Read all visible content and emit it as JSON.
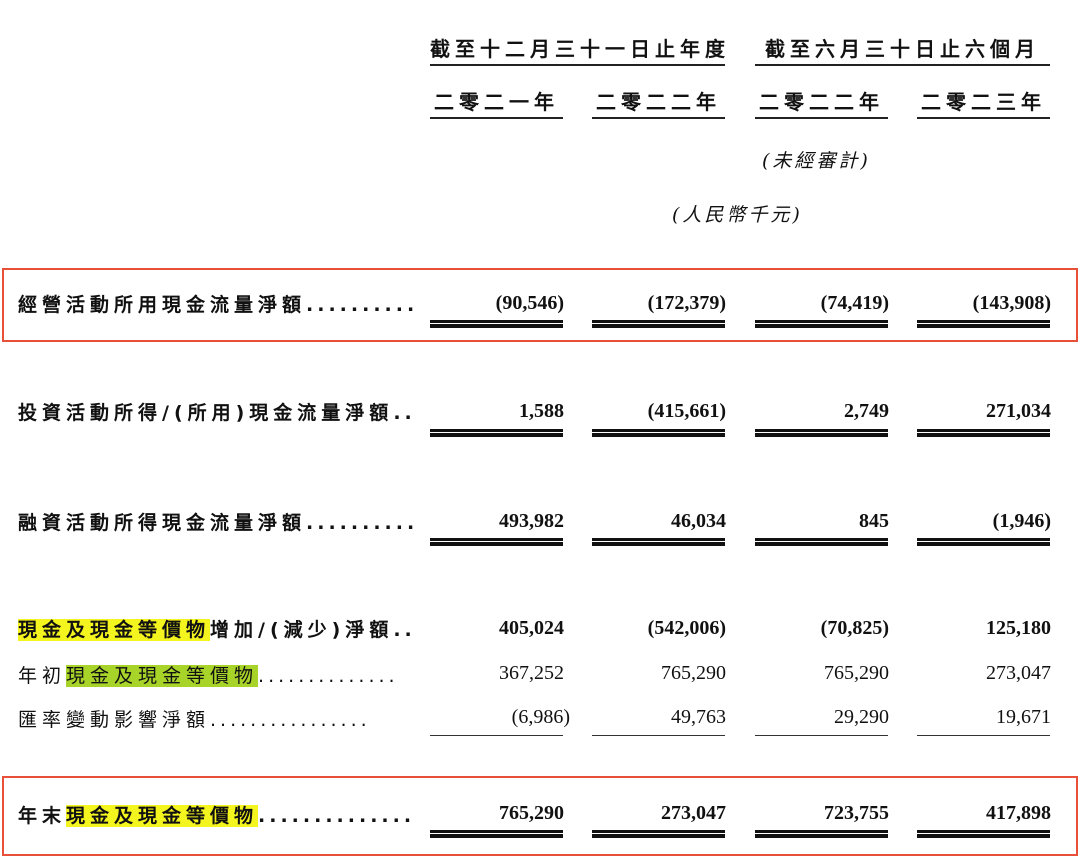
{
  "header": {
    "period_full_year": "截至十二月三十一日止年度",
    "period_six_months": "截至六月三十日止六個月",
    "years": [
      "二零二一年",
      "二零二二年",
      "二零二二年",
      "二零二三年"
    ],
    "unaudited": "(未經審計)",
    "currency": "(人民幣千元)"
  },
  "rows": [
    {
      "pre": "",
      "hl": "",
      "mid": "",
      "hl2": "",
      "post": "經營活動所用現金流量淨額",
      "dots": "..........",
      "values": [
        "(90,546)",
        "(172,379)",
        "(74,419)",
        "(143,908)"
      ]
    },
    {
      "pre": "",
      "hl": "",
      "mid": "",
      "hl2": "",
      "post": "投資活動所得/(所用)現金流量淨額",
      "dots": "..",
      "values": [
        "1,588",
        "(415,661)",
        "2,749",
        "271,034"
      ]
    },
    {
      "pre": "",
      "hl": "",
      "mid": "",
      "hl2": "",
      "post": "融資活動所得現金流量淨額",
      "dots": "..........",
      "values": [
        "493,982",
        "46,034",
        "845",
        "(1,946)"
      ]
    },
    {
      "pre": "",
      "hl": "現金及現金等價物",
      "mid": "",
      "hl2": "",
      "post": "增加/(減少)淨額",
      "dots": "..",
      "values": [
        "405,024",
        "(542,006)",
        "(70,825)",
        "125,180"
      ]
    },
    {
      "pre": "年初",
      "hl": "",
      "mid": "",
      "hl2": "現金及現金等價物",
      "post": "",
      "dots": "..............",
      "values": [
        "367,252",
        "765,290",
        "765,290",
        "273,047"
      ]
    },
    {
      "pre": "",
      "hl": "",
      "mid": "",
      "hl2": "",
      "post": "匯率變動影響淨額",
      "dots": "................",
      "values": [
        "(6,986)",
        "49,763",
        "29,290",
        "19,671"
      ]
    },
    {
      "pre": "年末",
      "hl": "現金及現金等價物",
      "mid": "",
      "hl2": "",
      "post": "",
      "dots": "..............",
      "values": [
        "765,290",
        "273,047",
        "723,755",
        "417,898"
      ]
    }
  ],
  "colors": {
    "highlight_yellow": "#f4f41e",
    "highlight_green": "#a8d42a",
    "box_red": "#e8503a"
  }
}
